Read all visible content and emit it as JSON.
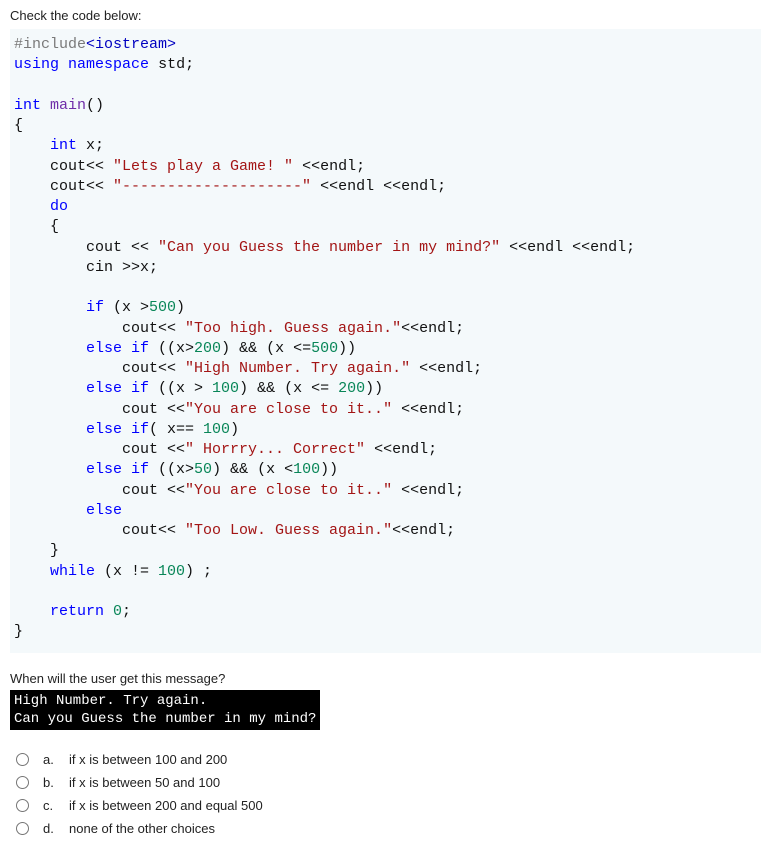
{
  "instruction": "Check the code below:",
  "code": {
    "l01a": "#include",
    "l01b": "<iostream>",
    "l02a": "using",
    "l02b": "namespace",
    "l02c": "std",
    "l02d": ";",
    "l03": "",
    "l04a": "int",
    "l04b": "main",
    "l04c": "()",
    "l05": "{",
    "l06a": "    int",
    "l06b": " x;",
    "l07a": "    cout<< ",
    "l07b": "\"Lets play a Game! \"",
    "l07c": " <<endl;",
    "l08a": "    cout<< ",
    "l08b": "\"--------------------\"",
    "l08c": " <<endl <<endl;",
    "l09a": "    do",
    "l10": "    {",
    "l11a": "        cout << ",
    "l11b": "\"Can you Guess the number in my mind?\"",
    "l11c": " <<endl <<endl;",
    "l12": "        cin >>x;",
    "l13": "",
    "l14a": "        if",
    "l14b": " (x >",
    "l14c": "500",
    "l14d": ")",
    "l15a": "            cout<< ",
    "l15b": "\"Too high. Guess again.\"",
    "l15c": "<<endl;",
    "l16a": "        else if",
    "l16b": " ((x>",
    "l16c": "200",
    "l16d": ") && (x <=",
    "l16e": "500",
    "l16f": "))",
    "l17a": "            cout<< ",
    "l17b": "\"High Number. Try again.\"",
    "l17c": " <<endl;",
    "l18a": "        else if",
    "l18b": " ((x > ",
    "l18c": "100",
    "l18d": ") && (x <= ",
    "l18e": "200",
    "l18f": "))",
    "l19a": "            cout <<",
    "l19b": "\"You are close to it..\"",
    "l19c": " <<endl;",
    "l20a": "        else if",
    "l20b": "( x== ",
    "l20c": "100",
    "l20d": ")",
    "l21a": "            cout <<",
    "l21b": "\" Horrry... Correct\"",
    "l21c": " <<endl;",
    "l22a": "        else if",
    "l22b": " ((x>",
    "l22c": "50",
    "l22d": ") && (x <",
    "l22e": "100",
    "l22f": "))",
    "l23a": "            cout <<",
    "l23b": "\"You are close to it..\"",
    "l23c": " <<endl;",
    "l24a": "        else",
    "l25a": "            cout<< ",
    "l25b": "\"Too Low. Guess again.\"",
    "l25c": "<<endl;",
    "l26": "    }",
    "l27a": "    while",
    "l27b": " (x != ",
    "l27c": "100",
    "l27d": ") ;",
    "l28": "",
    "l29a": "    return",
    "l29b": " ",
    "l29c": "0",
    "l29d": ";",
    "l30": "}"
  },
  "question": "When will the user get this message?",
  "console": {
    "line1": "High Number. Try again.",
    "line2": "Can you Guess the number in my mind?"
  },
  "options": [
    {
      "letter": "a.",
      "text": "if x is between 100 and 200"
    },
    {
      "letter": "b.",
      "text": "if x is between 50 and 100"
    },
    {
      "letter": "c.",
      "text": "if x is between 200 and equal 500"
    },
    {
      "letter": "d.",
      "text": "none of the other choices"
    }
  ]
}
